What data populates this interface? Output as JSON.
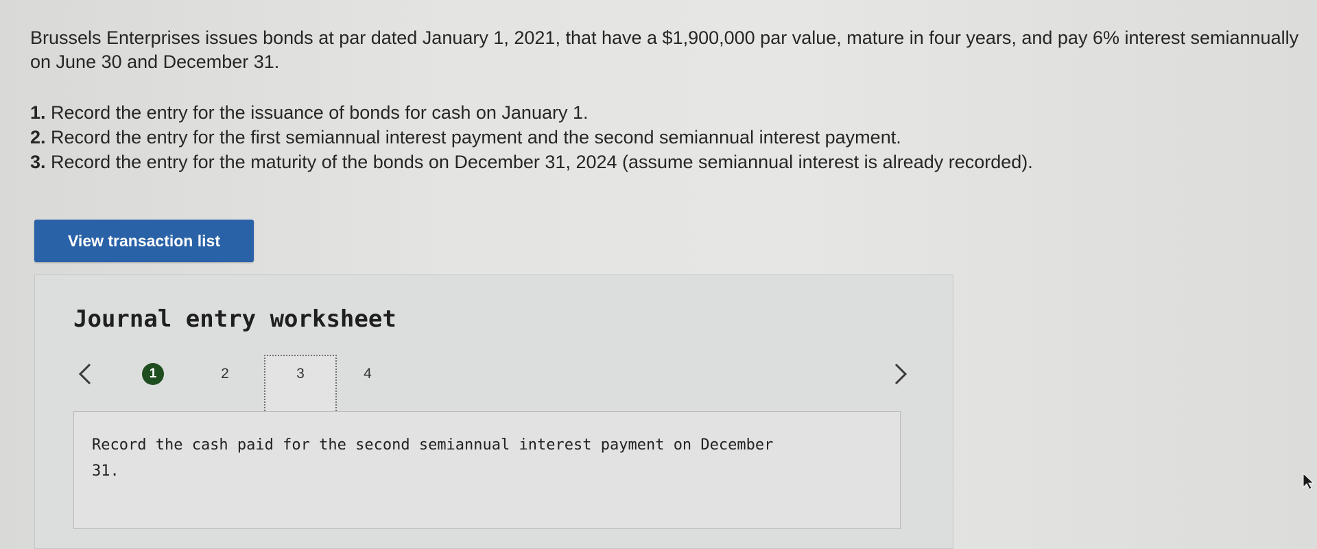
{
  "problem": {
    "intro": "Brussels Enterprises issues bonds at par dated January 1, 2021, that have a $1,900,000 par value, mature in four years, and pay 6% interest semiannually on June 30 and December 31.",
    "tasks": [
      {
        "number": "1.",
        "text": "Record the entry for the issuance of bonds for cash on January 1."
      },
      {
        "number": "2.",
        "text": "Record the entry for the first semiannual interest payment and the second semiannual interest payment."
      },
      {
        "number": "3.",
        "text": "Record the entry for the maturity of the bonds on December 31, 2024 (assume semiannual interest is already recorded)."
      }
    ]
  },
  "toolbar": {
    "view_transaction_list_label": "View transaction list",
    "button_color": "#2a62a8"
  },
  "worksheet": {
    "title": "Journal entry worksheet",
    "prev_icon": "chevron-left-icon",
    "next_icon": "chevron-right-icon",
    "steps": [
      {
        "label": "1",
        "state": "completed"
      },
      {
        "label": "2",
        "state": "default"
      },
      {
        "label": "3",
        "state": "current"
      },
      {
        "label": "4",
        "state": "default"
      }
    ],
    "completed_color": "#1e4d1f",
    "instruction": "Record the cash paid for the second semiannual interest payment on December 31."
  }
}
